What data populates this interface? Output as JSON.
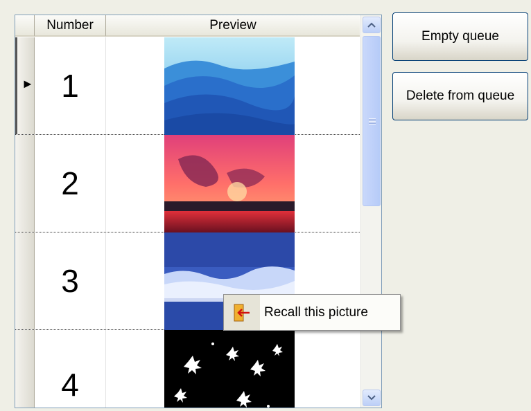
{
  "grid": {
    "columns": {
      "number": "Number",
      "preview": "Preview"
    },
    "rows": [
      {
        "number": "1",
        "preview": "blue-mountains-image",
        "current": true
      },
      {
        "number": "2",
        "preview": "sunset-over-water-image",
        "current": false
      },
      {
        "number": "3",
        "preview": "winter-frost-trees-image",
        "current": false
      },
      {
        "number": "4",
        "preview": "white-blossoms-on-black-image",
        "current": false
      }
    ]
  },
  "buttons": {
    "empty_queue": "Empty queue",
    "delete_from_queue": "Delete from queue"
  },
  "context_menu": {
    "recall": "Recall this picture"
  },
  "icons": {
    "current_row": "row-pointer-icon",
    "scroll_up": "chevron-up-icon",
    "scroll_down": "chevron-down-icon",
    "recall": "recall-arrow-icon"
  },
  "colors": {
    "scroll_accent": "#4d6185",
    "border": "#7f9db9",
    "button_border": "#003c74"
  }
}
